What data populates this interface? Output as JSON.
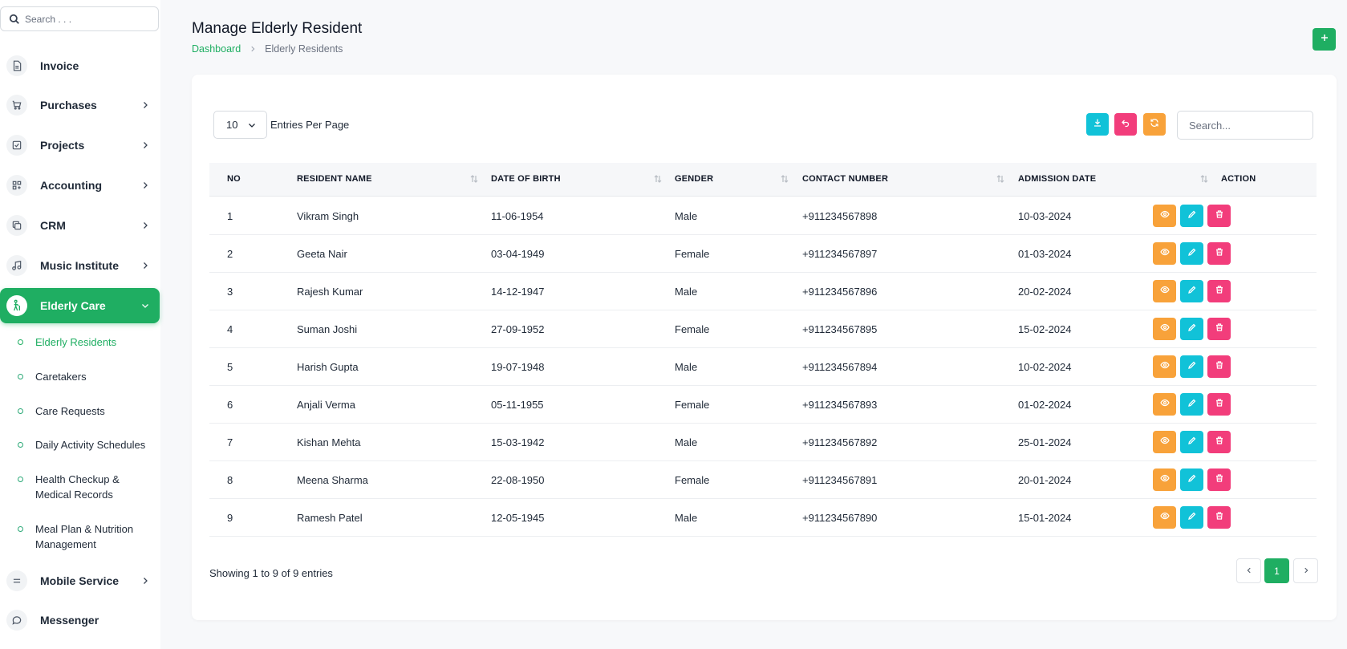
{
  "sidebar": {
    "search_placeholder": "Search . . .",
    "items": [
      {
        "label": "Invoice",
        "icon": "file-icon",
        "has_chevron": false
      },
      {
        "label": "Purchases",
        "icon": "cart-icon",
        "has_chevron": true
      },
      {
        "label": "Projects",
        "icon": "checkbox-icon",
        "has_chevron": true
      },
      {
        "label": "Accounting",
        "icon": "grid-icon",
        "has_chevron": true
      },
      {
        "label": "CRM",
        "icon": "copy-icon",
        "has_chevron": true
      },
      {
        "label": "Music Institute",
        "icon": "music-icon",
        "has_chevron": true
      },
      {
        "label": "Elderly Care",
        "icon": "elderly-icon",
        "has_chevron": true,
        "active": true
      },
      {
        "label": "Mobile Service",
        "icon": "menu-icon",
        "has_chevron": true
      },
      {
        "label": "Messenger",
        "icon": "chat-icon",
        "has_chevron": false
      }
    ],
    "sub_items": [
      {
        "label": "Elderly Residents",
        "active": true
      },
      {
        "label": "Caretakers"
      },
      {
        "label": "Care Requests"
      },
      {
        "label": "Daily Activity Schedules"
      },
      {
        "label": "Health Checkup & Medical Records"
      },
      {
        "label": "Meal Plan & Nutrition Management"
      }
    ]
  },
  "header": {
    "title": "Manage Elderly Resident",
    "breadcrumb": {
      "home": "Dashboard",
      "current": "Elderly Residents"
    },
    "add_button_label": "+"
  },
  "table_controls": {
    "entries_value": "10",
    "entries_label": "Entries Per Page",
    "search_placeholder": "Search..."
  },
  "table": {
    "columns": [
      "NO",
      "RESIDENT NAME",
      "DATE OF BIRTH",
      "GENDER",
      "CONTACT NUMBER",
      "ADMISSION DATE",
      "ACTION"
    ],
    "rows": [
      {
        "no": "1",
        "name": "Vikram Singh",
        "dob": "11-06-1954",
        "gender": "Male",
        "contact": "+911234567898",
        "admission": "10-03-2024"
      },
      {
        "no": "2",
        "name": "Geeta Nair",
        "dob": "03-04-1949",
        "gender": "Female",
        "contact": "+911234567897",
        "admission": "01-03-2024"
      },
      {
        "no": "3",
        "name": "Rajesh Kumar",
        "dob": "14-12-1947",
        "gender": "Male",
        "contact": "+911234567896",
        "admission": "20-02-2024"
      },
      {
        "no": "4",
        "name": "Suman Joshi",
        "dob": "27-09-1952",
        "gender": "Female",
        "contact": "+911234567895",
        "admission": "15-02-2024"
      },
      {
        "no": "5",
        "name": "Harish Gupta",
        "dob": "19-07-1948",
        "gender": "Male",
        "contact": "+911234567894",
        "admission": "10-02-2024"
      },
      {
        "no": "6",
        "name": "Anjali Verma",
        "dob": "05-11-1955",
        "gender": "Female",
        "contact": "+911234567893",
        "admission": "01-02-2024"
      },
      {
        "no": "7",
        "name": "Kishan Mehta",
        "dob": "15-03-1942",
        "gender": "Male",
        "contact": "+911234567892",
        "admission": "25-01-2024"
      },
      {
        "no": "8",
        "name": "Meena Sharma",
        "dob": "22-08-1950",
        "gender": "Female",
        "contact": "+911234567891",
        "admission": "20-01-2024"
      },
      {
        "no": "9",
        "name": "Ramesh Patel",
        "dob": "12-05-1945",
        "gender": "Male",
        "contact": "+911234567890",
        "admission": "15-01-2024"
      }
    ]
  },
  "footer": {
    "showing_text": "Showing 1 to 9 of 9 entries",
    "current_page": "1"
  },
  "colors": {
    "brand_green": "#1fae62",
    "view_orange": "#f8a23a",
    "edit_cyan": "#11c2d8",
    "delete_pink": "#f23d7b"
  }
}
